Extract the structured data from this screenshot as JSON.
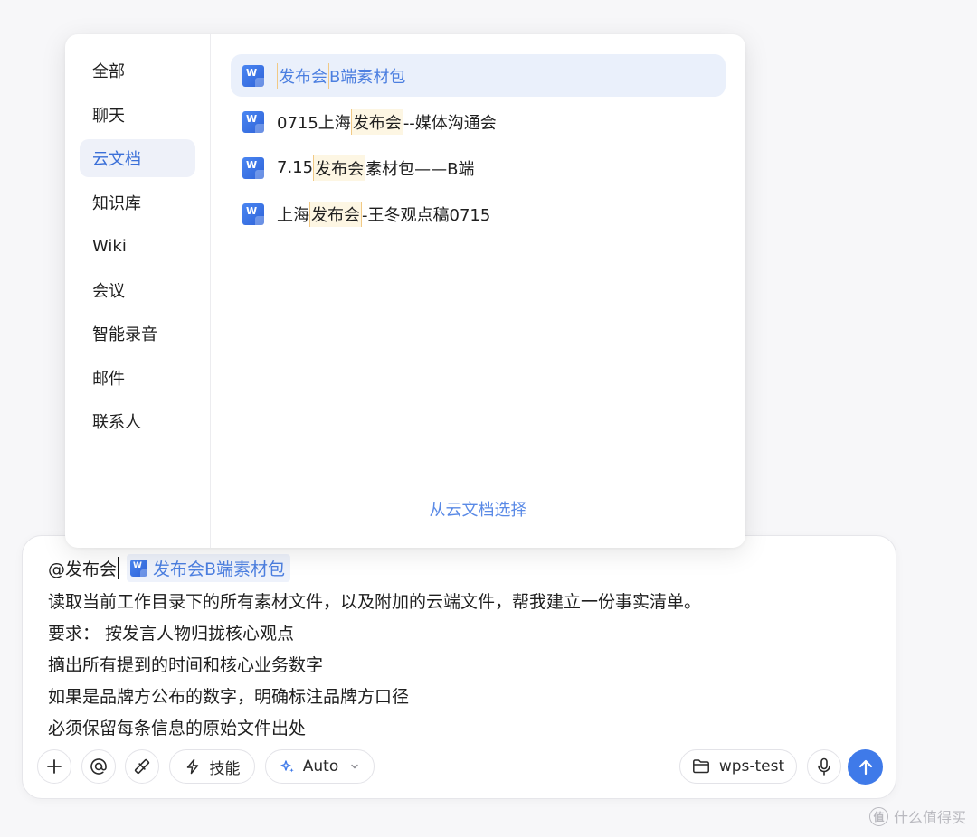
{
  "popup": {
    "categories": [
      {
        "label": "全部",
        "active": false
      },
      {
        "label": "聊天",
        "active": false
      },
      {
        "label": "云文档",
        "active": true
      },
      {
        "label": "知识库",
        "active": false
      },
      {
        "label": "Wiki",
        "active": false
      },
      {
        "label": "会议",
        "active": false
      },
      {
        "label": "智能录音",
        "active": false
      },
      {
        "label": "邮件",
        "active": false
      },
      {
        "label": "联系人",
        "active": false
      }
    ],
    "results": [
      {
        "pre": "",
        "hl": "发布会",
        "post": "B端素材包",
        "icon": "word-doc-icon",
        "active": true
      },
      {
        "pre": "0715上海",
        "hl": "发布会",
        "post": "--媒体沟通会",
        "icon": "word-doc-icon",
        "active": false
      },
      {
        "pre": "7.15",
        "hl": "发布会",
        "post": "素材包——B端",
        "icon": "word-doc-icon",
        "active": false
      },
      {
        "pre": "上海",
        "hl": "发布会",
        "post": "-王冬观点稿0715",
        "icon": "word-doc-icon",
        "active": false
      }
    ],
    "footer_action": "从云文档选择"
  },
  "composer": {
    "mention_text": "@发布会",
    "attached_chip": "发布会B端素材包",
    "lines": [
      "读取当前工作目录下的所有素材文件，以及附加的云端文件，帮我建立一份事实清单。",
      "要求： 按发言人物归拢核心观点",
      "摘出所有提到的时间和核心业务数字",
      "如果是品牌方公布的数字，明确标注品牌方口径",
      "必须保留每条信息的原始文件出处"
    ],
    "toolbar": {
      "skills_label": "技能",
      "model_label": "Auto",
      "folder_label": "wps-test"
    }
  },
  "watermark": {
    "badge": "值",
    "text": "什么值得买"
  },
  "colors": {
    "accent": "#3f7ae9",
    "active_item_bg": "#eef1f9",
    "highlight_bg": "#fdf6e3"
  }
}
